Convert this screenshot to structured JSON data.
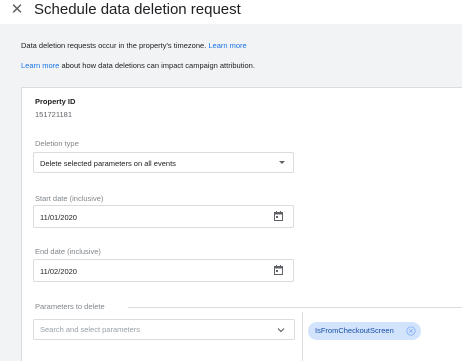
{
  "header": {
    "title": "Schedule data deletion request",
    "close_glyph": "✕"
  },
  "info": {
    "line1_text": "Data deletion requests occur in the property's timezone.",
    "line1_link": "Learn more",
    "line2_link": "Learn more",
    "line2_text": "about how data deletions can impact campaign attribution."
  },
  "form": {
    "property_id_label": "Property ID",
    "property_id_value": "151721181",
    "deletion_type_label": "Deletion type",
    "deletion_type_value": "Delete selected parameters on all events",
    "start_date_label": "Start date (inclusive)",
    "start_date_value": "11/01/2020",
    "end_date_label": "End date (inclusive)",
    "end_date_value": "11/02/2020",
    "parameters_label": "Parameters to delete",
    "parameters_placeholder": "Search and select parameters",
    "selected_parameters": [
      "IsFromCheckoutScreen"
    ]
  },
  "colors": {
    "link": "#1a73e8",
    "chip_bg": "#d2e3fc",
    "chip_text": "#174ea6"
  },
  "icons": [
    "close-icon",
    "dropdown-arrow-icon",
    "calendar-icon",
    "chevron-down-icon",
    "chip-remove-icon"
  ]
}
